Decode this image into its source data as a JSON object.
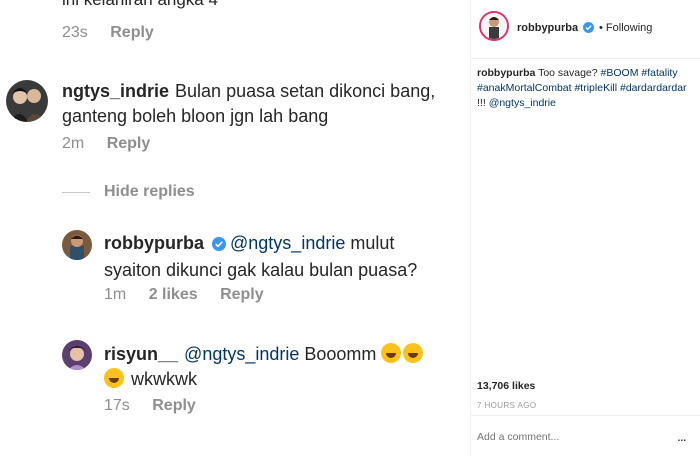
{
  "thread": {
    "top_partial_text": "ini kelahiran angka 4",
    "first_meta": {
      "time": "23s",
      "reply": "Reply"
    },
    "comment": {
      "username": "ngtys_indrie",
      "text_line1": "Bulan puasa setan dikonci bang,",
      "text_line2": "ganteng boleh bloon jgn lah bang",
      "time": "2m",
      "reply": "Reply"
    },
    "hide_replies": "Hide replies",
    "replies": [
      {
        "username": "robbypurba",
        "mention": "@ngtys_indrie",
        "text_line1": " mulut",
        "text_line2": "syaiton dikunci gak kalau bulan puasa?",
        "time": "1m",
        "likes": "2 likes",
        "reply": "Reply"
      },
      {
        "username": "risyun__",
        "mention": "@ngtys_indrie",
        "text_line1": " Booomm",
        "text_line2": " wkwkwk",
        "time": "17s",
        "reply": "Reply"
      }
    ]
  },
  "panel": {
    "username": "robbypurba",
    "follow_status": "Following",
    "caption": {
      "username": "robbypurba",
      "text": " Too savage? ",
      "tags": [
        "#BOOM",
        "#fatality",
        "#anakMortalCombat",
        "#tripleKill",
        "#dardardardar",
        "!!!",
        "@ngtys_indrie"
      ]
    },
    "likes": "13,706 likes",
    "time": "7 HOURS AGO",
    "comment_placeholder": "Add a comment...",
    "more_label": "..."
  },
  "colors": {
    "link": "#003569",
    "muted": "#8e8e8e",
    "verified": "#3897f0",
    "story_ring": "#e1306c"
  },
  "icons": [
    "verified-badge-icon",
    "rofl-emoji-icon",
    "more-options-icon"
  ]
}
